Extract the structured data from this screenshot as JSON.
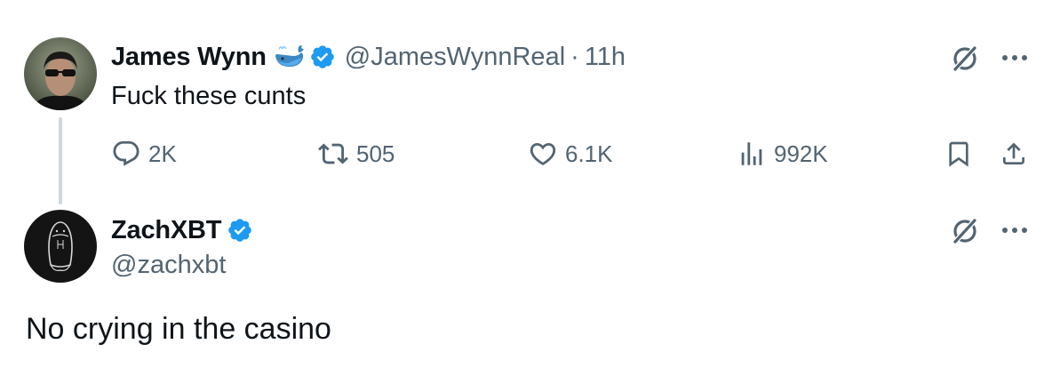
{
  "tweet": {
    "author_name": "James Wynn",
    "handle": "@JamesWynnReal",
    "separator": "·",
    "time": "11h",
    "text": "Fuck these cunts",
    "actions": {
      "replies": "2K",
      "reposts": "505",
      "likes": "6.1K",
      "views": "992K"
    }
  },
  "reply": {
    "author_name": "ZachXBT",
    "handle": "@zachxbt",
    "text": "No crying in the casino"
  },
  "colors": {
    "verified": "#1d9bf0",
    "muted": "#536471",
    "thread_line": "#cfd9de",
    "text": "#0f1419"
  },
  "icons": [
    "whale-icon",
    "verified-badge-icon",
    "grok-icon",
    "more-icon",
    "reply-icon",
    "repost-icon",
    "like-icon",
    "views-icon",
    "bookmark-icon",
    "share-icon"
  ]
}
